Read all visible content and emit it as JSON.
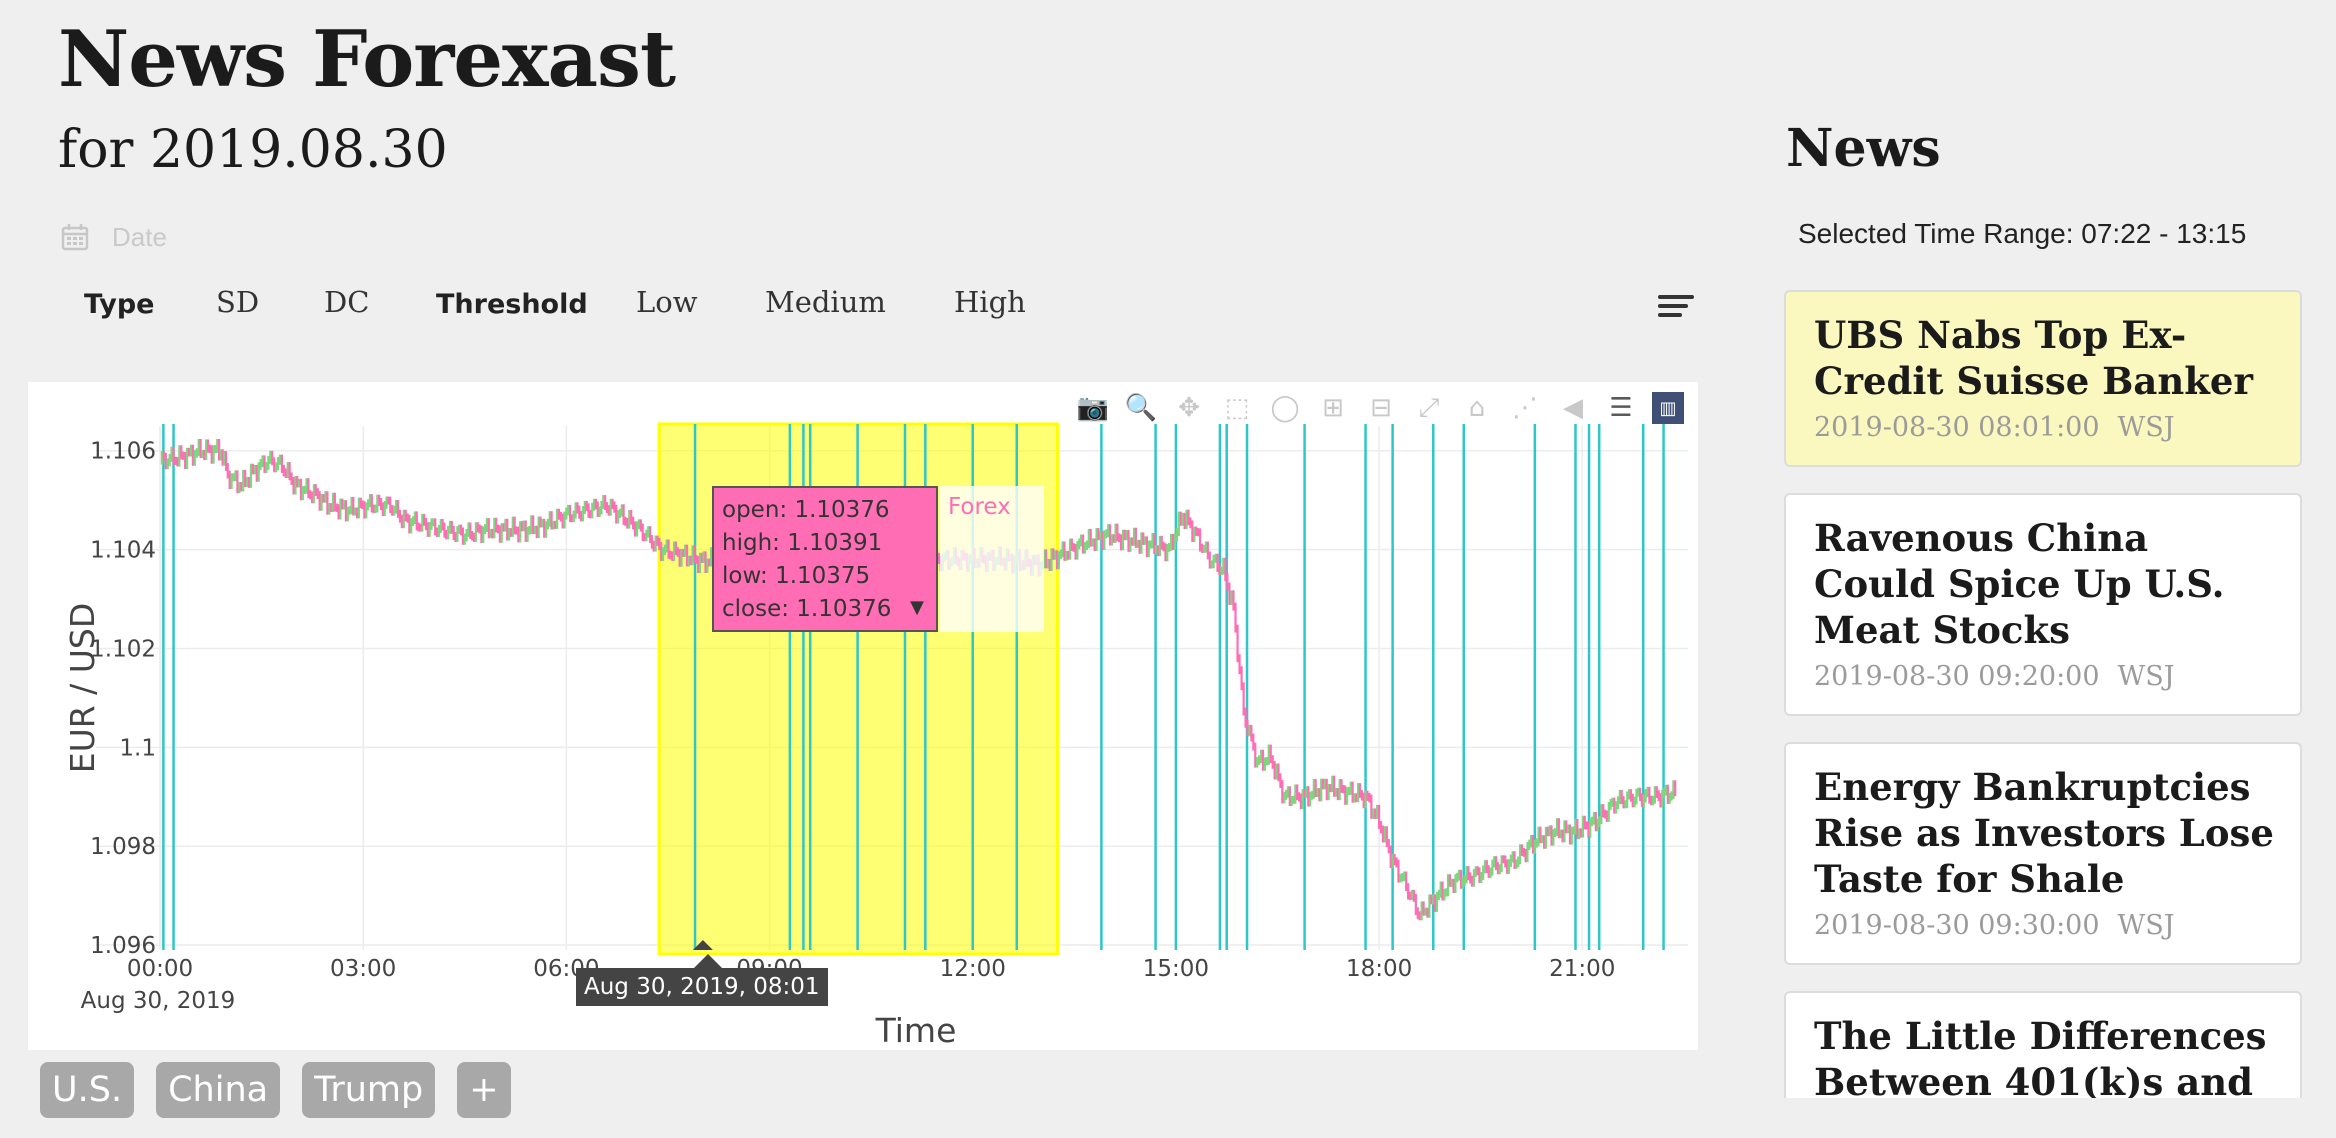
{
  "header": {
    "title": "News Forexast",
    "subtitle": "for 2019.08.30",
    "date_placeholder": "Date"
  },
  "filters": {
    "type_label": "Type",
    "sd": "SD",
    "dc": "DC",
    "threshold_label": "Threshold",
    "low": "Low",
    "medium": "Medium",
    "high": "High"
  },
  "chart": {
    "hover": {
      "open": "open: 1.10376",
      "high": "high: 1.10391",
      "low": "low: 1.10375",
      "close": "close: 1.10376",
      "series": "Forex"
    },
    "x_hover_label": "Aug 30, 2019, 08:01",
    "colors": {
      "up": "#7ed67e",
      "down": "#ff6eb4",
      "event_line": "#2ec7c7",
      "selection": "#ffff00"
    }
  },
  "chart_data": {
    "type": "candlestick",
    "xlabel": "Time",
    "ylabel": "EUR / USD",
    "x_ticks": [
      "00:00",
      "03:00",
      "06:00",
      "09:00",
      "12:00",
      "15:00",
      "18:00",
      "21:00"
    ],
    "x_date_label": "Aug 30, 2019",
    "y_ticks": [
      "1.096",
      "1.098",
      "1.1",
      "1.102",
      "1.104",
      "1.106"
    ],
    "ylim": [
      1.0959,
      1.1065
    ],
    "xlim_hours": [
      0,
      22.4
    ],
    "selected_range_hours": [
      7.37,
      13.25
    ],
    "event_line_hours": [
      0.05,
      0.2,
      7.9,
      9.3,
      9.5,
      9.6,
      10.3,
      11.0,
      11.3,
      12.0,
      12.65,
      13.9,
      14.7,
      15.0,
      15.65,
      15.75,
      16.05,
      16.9,
      17.8,
      18.2,
      18.8,
      19.25,
      20.3,
      20.9,
      21.1,
      21.25,
      21.9,
      22.2
    ],
    "price_series": [
      [
        0.0,
        1.1058
      ],
      [
        0.4,
        1.1059
      ],
      [
        0.6,
        1.106
      ],
      [
        0.9,
        1.106
      ],
      [
        1.0,
        1.1055
      ],
      [
        1.2,
        1.1053
      ],
      [
        1.4,
        1.1056
      ],
      [
        1.6,
        1.1058
      ],
      [
        1.8,
        1.1057
      ],
      [
        2.0,
        1.1053
      ],
      [
        2.3,
        1.1051
      ],
      [
        2.5,
        1.1049
      ],
      [
        2.8,
        1.1048
      ],
      [
        3.1,
        1.1049
      ],
      [
        3.4,
        1.1049
      ],
      [
        3.6,
        1.1046
      ],
      [
        3.9,
        1.1045
      ],
      [
        4.2,
        1.1044
      ],
      [
        4.5,
        1.1043
      ],
      [
        4.8,
        1.1044
      ],
      [
        5.1,
        1.1044
      ],
      [
        5.4,
        1.1044
      ],
      [
        5.7,
        1.1045
      ],
      [
        6.0,
        1.1047
      ],
      [
        6.3,
        1.1048
      ],
      [
        6.6,
        1.1049
      ],
      [
        6.9,
        1.1046
      ],
      [
        7.1,
        1.1044
      ],
      [
        7.4,
        1.104
      ],
      [
        7.7,
        1.1039
      ],
      [
        8.0,
        1.10376
      ],
      [
        8.3,
        1.1038
      ],
      [
        8.6,
        1.1039
      ],
      [
        9.0,
        1.1039
      ],
      [
        9.5,
        1.1038
      ],
      [
        10.0,
        1.1039
      ],
      [
        10.5,
        1.1038
      ],
      [
        11.0,
        1.1039
      ],
      [
        11.5,
        1.1038
      ],
      [
        12.0,
        1.1038
      ],
      [
        12.5,
        1.1038
      ],
      [
        13.0,
        1.1037
      ],
      [
        13.3,
        1.1039
      ],
      [
        13.6,
        1.1041
      ],
      [
        14.0,
        1.1043
      ],
      [
        14.3,
        1.1042
      ],
      [
        14.6,
        1.1041
      ],
      [
        14.9,
        1.104
      ],
      [
        15.1,
        1.1047
      ],
      [
        15.3,
        1.1043
      ],
      [
        15.5,
        1.1038
      ],
      [
        15.7,
        1.1036
      ],
      [
        15.85,
        1.1028
      ],
      [
        16.0,
        1.1007
      ],
      [
        16.2,
        1.0997
      ],
      [
        16.4,
        1.0998
      ],
      [
        16.6,
        1.099
      ],
      [
        16.9,
        1.099
      ],
      [
        17.2,
        1.0992
      ],
      [
        17.5,
        1.0991
      ],
      [
        17.8,
        1.099
      ],
      [
        18.0,
        1.0985
      ],
      [
        18.2,
        1.0977
      ],
      [
        18.4,
        1.0972
      ],
      [
        18.6,
        1.0966
      ],
      [
        18.8,
        1.0969
      ],
      [
        19.1,
        1.0973
      ],
      [
        19.4,
        1.0974
      ],
      [
        19.7,
        1.0976
      ],
      [
        20.0,
        1.0977
      ],
      [
        20.3,
        1.0981
      ],
      [
        20.6,
        1.0983
      ],
      [
        20.9,
        1.0983
      ],
      [
        21.2,
        1.0985
      ],
      [
        21.5,
        1.0989
      ],
      [
        21.8,
        1.099
      ],
      [
        22.1,
        1.099
      ],
      [
        22.4,
        1.0991
      ]
    ]
  },
  "tags": [
    "U.S.",
    "China",
    "Trump",
    "+"
  ],
  "news": {
    "header": "News",
    "range_label": "Selected Time Range: 07:22 - 13:15",
    "items": [
      {
        "title": "UBS Nabs Top Ex-Credit Suisse Banker",
        "time": "2019-08-30 08:01:00",
        "source": "WSJ"
      },
      {
        "title": "Ravenous China Could Spice Up U.S. Meat Stocks",
        "time": "2019-08-30 09:20:00",
        "source": "WSJ"
      },
      {
        "title": "Energy Bankruptcies Rise as Investors Lose Taste for Shale",
        "time": "2019-08-30 09:30:00",
        "source": "WSJ"
      },
      {
        "title": "The Little Differences Between 401(k)s and",
        "time": "",
        "source": ""
      }
    ]
  }
}
